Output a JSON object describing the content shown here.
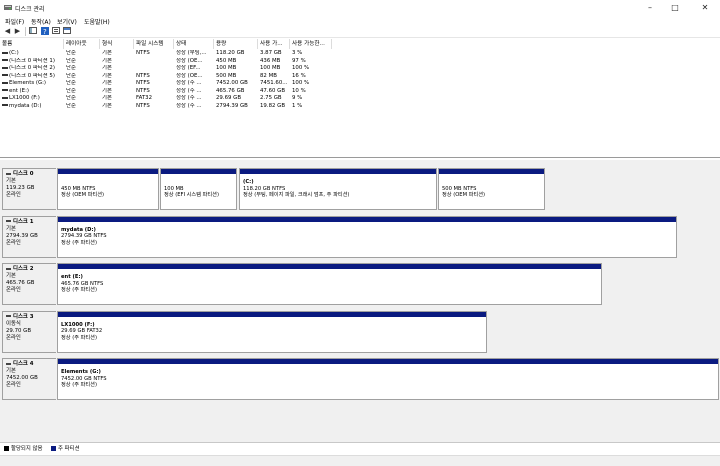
{
  "window": {
    "title": "디스크 관리",
    "icons": {
      "app": "disk-management-icon",
      "minimize": "minimize-icon",
      "maximize": "maximize-icon",
      "close": "close-icon"
    }
  },
  "menu": [
    "파일(F)",
    "동작(A)",
    "보기(V)",
    "도움말(H)"
  ],
  "toolbar": {
    "icons": [
      "back-arrow-icon",
      "forward-arrow-icon",
      "console-tree-icon",
      "help-icon",
      "properties-icon",
      "show-hide-icon"
    ]
  },
  "volume_list": {
    "columns": [
      "볼륨",
      "레이아웃",
      "형식",
      "파일 시스템",
      "상태",
      "용량",
      "사용 가...",
      "사용 가능한..."
    ],
    "rows": [
      [
        "(C:)",
        "단순",
        "기본",
        "NTFS",
        "정상 (부팅,...",
        "118.20 GB",
        "3.87 GB",
        "3 %"
      ],
      [
        "(디스크 0 파티션 1)",
        "단순",
        "기본",
        "",
        "정상 (OE...",
        "450 MB",
        "436 MB",
        "97 %"
      ],
      [
        "(디스크 0 파티션 2)",
        "단순",
        "기본",
        "",
        "정상 (EF...",
        "100 MB",
        "100 MB",
        "100 %"
      ],
      [
        "(디스크 0 파티션 5)",
        "단순",
        "기본",
        "NTFS",
        "정상 (OE...",
        "500 MB",
        "82 MB",
        "16 %"
      ],
      [
        "Elements (G:)",
        "단순",
        "기본",
        "NTFS",
        "정상 (주 ...",
        "7452.00 GB",
        "7451.60...",
        "100 %"
      ],
      [
        "ent (E:)",
        "단순",
        "기본",
        "NTFS",
        "정상 (주 ...",
        "465.76 GB",
        "47.60 GB",
        "10 %"
      ],
      [
        "LX1000 (F:)",
        "단순",
        "기본",
        "FAT32",
        "정상 (주 ...",
        "29.69 GB",
        "2.75 GB",
        "9 %"
      ],
      [
        "mydata (D:)",
        "단순",
        "기본",
        "NTFS",
        "정상 (주 ...",
        "2794.39 GB",
        "19.82 GB",
        "1 %"
      ]
    ]
  },
  "disks": [
    {
      "name": "디스크 0",
      "type": "기본",
      "size": "119.23 GB",
      "status": "온라인",
      "partitions": [
        {
          "name": "",
          "line1": "450 MB NTFS",
          "line2": "정상 (OEM 파티션)"
        },
        {
          "name": "",
          "line1": "100 MB",
          "line2": "정상 (EFI 시스템 파티션)"
        },
        {
          "name": "(C:)",
          "line1": "118.20 GB NTFS",
          "line2": "정상 (부팅, 페이지 파일, 크래시 덤프, 주 파티션)"
        },
        {
          "name": "",
          "line1": "500 MB NTFS",
          "line2": "정상 (OEM 파티션)"
        }
      ]
    },
    {
      "name": "디스크 1",
      "type": "기본",
      "size": "2794.39 GB",
      "status": "온라인",
      "partitions": [
        {
          "name": "mydata  (D:)",
          "line1": "2794.39 GB NTFS",
          "line2": "정상 (주 파티션)"
        }
      ]
    },
    {
      "name": "디스크 2",
      "type": "기본",
      "size": "465.76 GB",
      "status": "온라인",
      "partitions": [
        {
          "name": "ent  (E:)",
          "line1": "465.76 GB NTFS",
          "line2": "정상 (주 파티션)"
        }
      ]
    },
    {
      "name": "디스크 3",
      "type": "이동식",
      "size": "29.70 GB",
      "status": "온라인",
      "partitions": [
        {
          "name": "LX1000  (F:)",
          "line1": "29.69 GB FAT32",
          "line2": "정상 (주 파티션)"
        }
      ]
    },
    {
      "name": "디스크 4",
      "type": "기본",
      "size": "7452.00 GB",
      "status": "온라인",
      "partitions": [
        {
          "name": "Elements  (G:)",
          "line1": "7452.00 GB NTFS",
          "line2": "정상 (주 파티션)"
        }
      ]
    }
  ],
  "legend": [
    {
      "label": "할당되지 않음",
      "color": "#000000"
    },
    {
      "label": "주 파티션",
      "color": "#0a1a80"
    }
  ]
}
